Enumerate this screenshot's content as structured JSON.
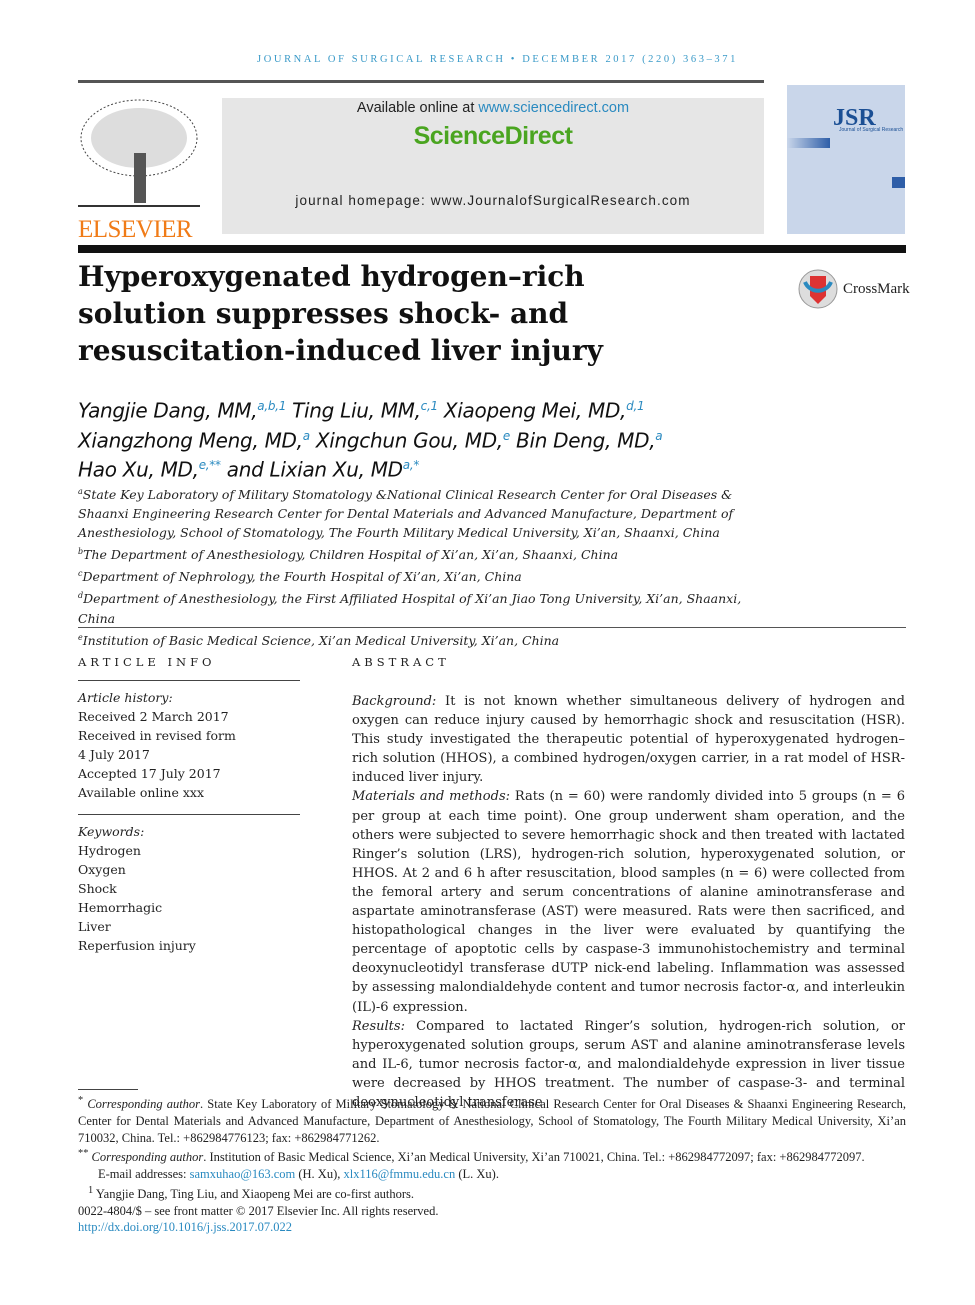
{
  "journal_header": "JOURNAL OF SURGICAL RESEARCH • DECEMBER 2017 (220) 363–371",
  "publisher": "ELSEVIER",
  "banner": {
    "available": "Available online at ",
    "sd_url": "www.sciencedirect.com",
    "brand": "ScienceDirect",
    "homepage": "journal homepage: www.JournalofSurgicalResearch.com"
  },
  "cover": {
    "logo": "JSR",
    "subtitle": "Journal of Surgical Research"
  },
  "colors": {
    "accent": "#2a8ac0",
    "brand_green": "#4aa520",
    "elsevier_orange": "#f07b17"
  },
  "title": "Hyperoxygenated hydrogen–rich solution suppresses shock- and resuscitation-induced liver injury",
  "crossmark": "CrossMark",
  "authors": [
    {
      "name": "Yangjie Dang, MM,",
      "sup": "a,b,1"
    },
    {
      "name": "Ting Liu, MM,",
      "sup": "c,1"
    },
    {
      "name": "Xiaopeng Mei, MD,",
      "sup": "d,1"
    },
    {
      "name": "Xiangzhong Meng, MD,",
      "sup": "a"
    },
    {
      "name": "Xingchun Gou, MD,",
      "sup": "e"
    },
    {
      "name": "Bin Deng, MD,",
      "sup": "a"
    },
    {
      "name": "Hao Xu, MD,",
      "sup": "e,**"
    },
    {
      "name": "and Lixian Xu, MD",
      "sup": "a,*"
    }
  ],
  "affiliations": [
    {
      "key": "a",
      "text": "State Key Laboratory of Military Stomatology &National Clinical Research Center for Oral Diseases & Shaanxi Engineering Research Center for Dental Materials and Advanced Manufacture, Department of Anesthesiology, School of Stomatology, The Fourth Military Medical University, Xi’an, Shaanxi, China"
    },
    {
      "key": "b",
      "text": "The Department of Anesthesiology, Children Hospital of Xi’an, Xi’an, Shaanxi, China"
    },
    {
      "key": "c",
      "text": "Department of Nephrology, the Fourth Hospital of Xi’an, Xi’an, China"
    },
    {
      "key": "d",
      "text": "Department of Anesthesiology, the First Affiliated Hospital of Xi’an Jiao Tong University, Xi’an, Shaanxi, China"
    },
    {
      "key": "e",
      "text": "Institution of Basic Medical Science, Xi’an Medical University, Xi’an, China"
    }
  ],
  "article_info": {
    "heading": "ARTICLE INFO",
    "history_label": "Article history:",
    "history": [
      "Received 2 March 2017",
      "Received in revised form",
      "4 July 2017",
      "Accepted 17 July 2017",
      "Available online xxx"
    ],
    "keywords_label": "Keywords:",
    "keywords": [
      "Hydrogen",
      "Oxygen",
      "Shock",
      "Hemorrhagic",
      "Liver",
      "Reperfusion injury"
    ]
  },
  "abstract": {
    "heading": "ABSTRACT",
    "sections": [
      {
        "label": "Background:",
        "text": " It is not known whether simultaneous delivery of hydrogen and oxygen can reduce injury caused by hemorrhagic shock and resuscitation (HSR). This study investigated the therapeutic potential of hyperoxygenated hydrogen–rich solution (HHOS), a combined hydrogen/oxygen carrier, in a rat model of HSR-induced liver injury."
      },
      {
        "label": "Materials and methods:",
        "text": " Rats (n = 60) were randomly divided into 5 groups (n = 6 per group at each time point). One group underwent sham operation, and the others were subjected to severe hemorrhagic shock and then treated with lactated Ringer’s solution (LRS), hydrogen-rich solution, hyperoxygenated solution, or HHOS. At 2 and 6 h after resuscitation, blood samples (n = 6) were collected from the femoral artery and serum concentrations of alanine aminotransferase and aspartate aminotransferase (AST) were measured. Rats were then sacrificed, and histopathological changes in the liver were evaluated by quantifying the percentage of apoptotic cells by caspase-3 immunohistochemistry and terminal deoxynucleotidyl transferase dUTP nick-end labeling. Inflammation was assessed by assessing malondialdehyde content and tumor necrosis factor-α, and interleukin (IL)-6 expression."
      },
      {
        "label": "Results:",
        "text": " Compared to lactated Ringer’s solution, hydrogen-rich solution, or hyperoxygenated solution groups, serum AST and alanine aminotransferase levels and IL-6, tumor necrosis factor-α, and malondialdehyde expression in liver tissue were decreased by HHOS treatment. The number of caspase-3- and terminal deoxynucleotidyl transferase"
      }
    ]
  },
  "footnotes": {
    "corr1_label": "Corresponding author",
    "corr1": ". State Key Laboratory of Military Stomatology & National Clinical Research Center for Oral Diseases & Shaanxi Engineering Research, Center for Dental Materials and Advanced Manufacture, Department of Anesthesiology, School of Stomatology, The Fourth Military Medical University, Xi’an 710032, China. Tel.: +862984776123; fax: +862984771262.",
    "corr2_label": "Corresponding author",
    "corr2": ". Institution of Basic Medical Science, Xi’an Medical University, Xi’an 710021, China. Tel.: +862984772097; fax: +862984772097.",
    "email_label": "E-mail addresses: ",
    "email1": "samxuhao@163.com",
    "email1_who": " (H. Xu), ",
    "email2": "xlx116@fmmu.edu.cn",
    "email2_who": " (L. Xu).",
    "cofirst": "Yangjie Dang, Ting Liu, and Xiaopeng Mei are co-first authors.",
    "copyright": "0022-4804/$ – see front matter © 2017 Elsevier Inc. All rights reserved.",
    "doi": "http://dx.doi.org/10.1016/j.jss.2017.07.022"
  }
}
